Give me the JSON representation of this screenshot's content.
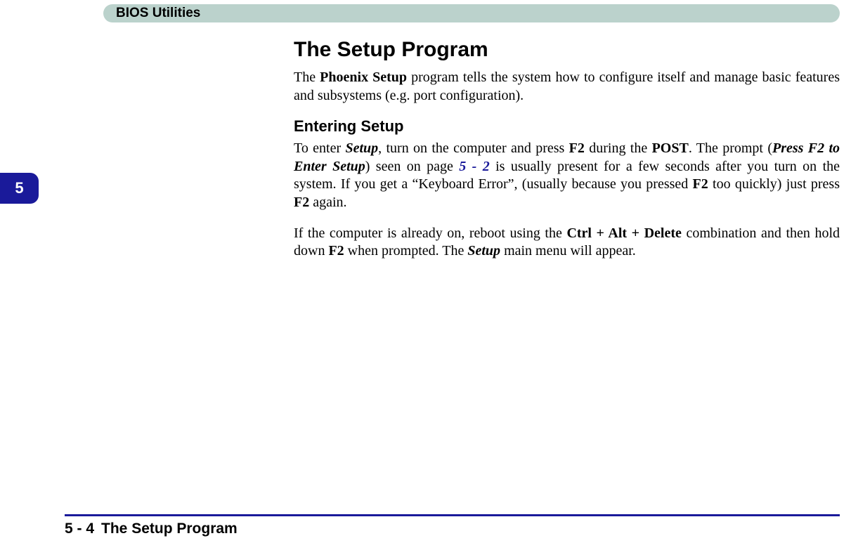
{
  "header": {
    "title": "BIOS Utilities"
  },
  "tab": {
    "chapter": "5"
  },
  "content": {
    "title": "The Setup Program",
    "p1a": "The ",
    "p1b": "Phoenix Setup",
    "p1c": " program tells the system how to configure itself and manage basic features and subsystems (e.g. port configuration).",
    "subheading": "Entering Setup",
    "p2a": "To enter ",
    "p2b": "Setup",
    "p2c": ", turn on the computer and press ",
    "p2d": "F2",
    "p2e": " during the ",
    "p2f": "POST",
    "p2g": ". The prompt (",
    "p2h": "Press F2 to Enter Setup",
    "p2i": ") seen on page ",
    "p2j": "5 - 2",
    "p2k": " is usually present for a few seconds after you turn on the system. If you get a “Keyboard Error”, (usually because you pressed ",
    "p2l": "F2",
    "p2m": " too quickly) just press ",
    "p2n": "F2",
    "p2o": " again.",
    "p3a": "If the computer is already on, reboot using the ",
    "p3b": "Ctrl + Alt + Delete",
    "p3c": " combination and then hold down ",
    "p3d": "F2",
    "p3e": " when prompted. The ",
    "p3f": "Setup",
    "p3g": " main menu will appear."
  },
  "footer": {
    "page": "5 - 4",
    "title": "The Setup Program"
  }
}
